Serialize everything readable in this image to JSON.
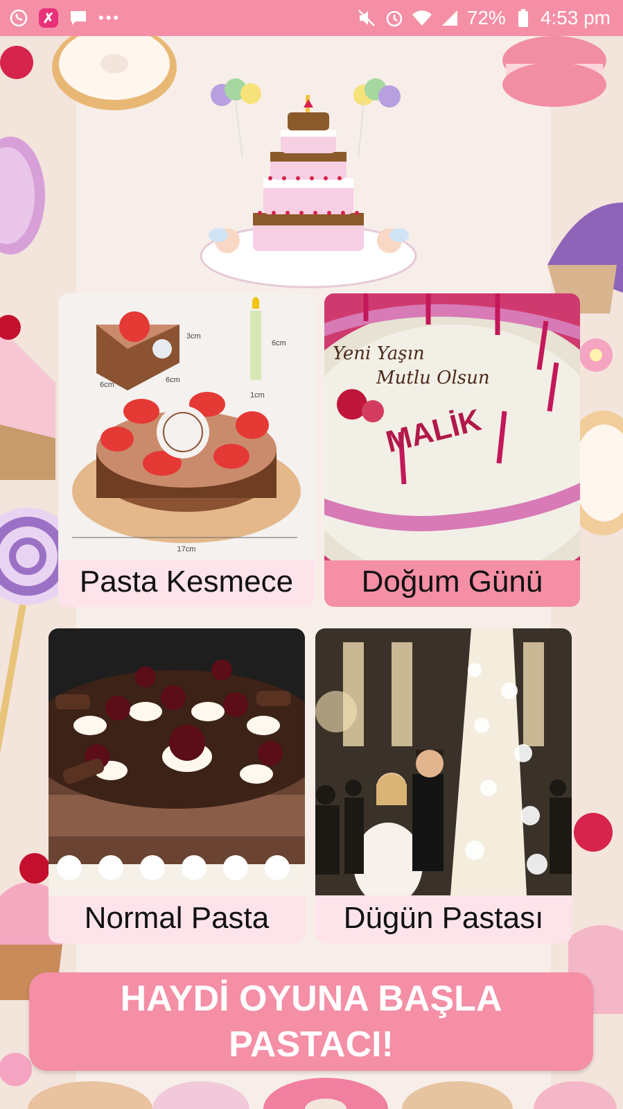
{
  "status_bar": {
    "battery": "72%",
    "time": "4:53 pm",
    "left_icons": [
      "whatsapp-icon",
      "app-badge-icon",
      "message-icon",
      "more-dots-icon"
    ],
    "right_icons": [
      "mute-icon",
      "alarm-icon",
      "wifi-icon",
      "signal-icon",
      "battery-icon"
    ]
  },
  "categories": [
    {
      "label": "Pasta Kesmece"
    },
    {
      "label": "Doğum Günü"
    },
    {
      "label": "Normal Pasta"
    },
    {
      "label": "Dügün Pastası"
    }
  ],
  "toy_cake_dims": {
    "a": "3cm",
    "b": "6cm",
    "c": "6cm",
    "d": "6cm",
    "e": "1cm",
    "f": "17cm"
  },
  "birthday_cake_text": {
    "line1": "Yeni Yaşın",
    "line2": "Mutlu Olsun",
    "name": "MALİK"
  },
  "start_button": {
    "line1": "HAYDİ OYUNA BAŞLA",
    "line2": "PASTACI!"
  },
  "colors": {
    "accent": "#f48fa6",
    "card_bg": "#fde3ea",
    "background": "#f3e4dc"
  }
}
